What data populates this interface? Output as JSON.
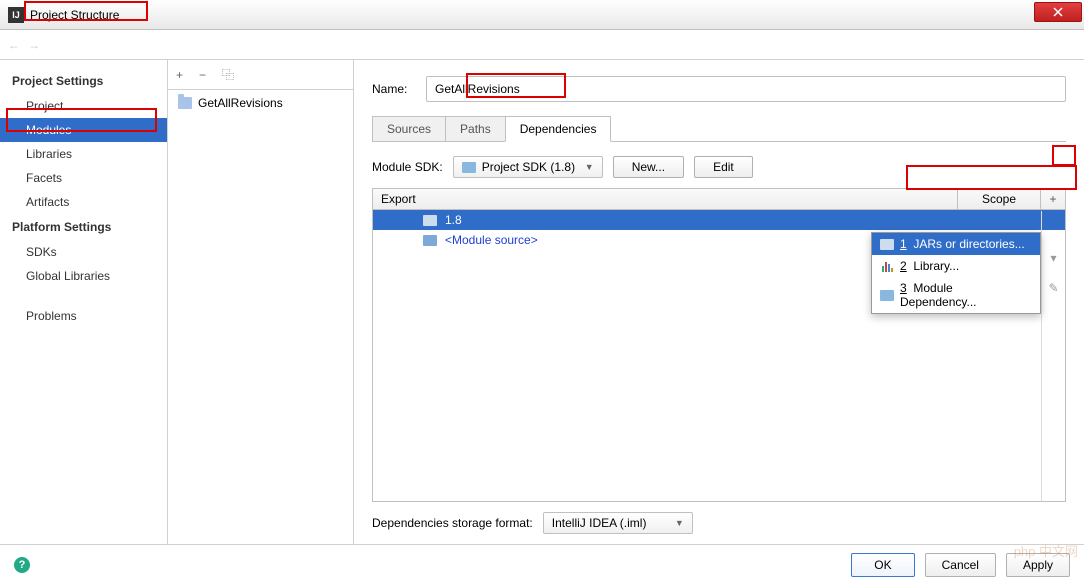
{
  "window": {
    "title": "Project Structure",
    "icon_text": "IJ"
  },
  "sidebar": {
    "sections": [
      {
        "heading": "Project Settings",
        "items": [
          {
            "label": "Project",
            "selected": false
          },
          {
            "label": "Modules",
            "selected": true
          },
          {
            "label": "Libraries",
            "selected": false
          },
          {
            "label": "Facets",
            "selected": false
          },
          {
            "label": "Artifacts",
            "selected": false
          }
        ]
      },
      {
        "heading": "Platform Settings",
        "items": [
          {
            "label": "SDKs",
            "selected": false
          },
          {
            "label": "Global Libraries",
            "selected": false
          }
        ]
      },
      {
        "heading": "",
        "items": [
          {
            "label": "Problems",
            "selected": false
          }
        ]
      }
    ]
  },
  "middle": {
    "toolbar_icons": {
      "add": "+",
      "remove": "−",
      "copy": "⿻"
    },
    "items": [
      {
        "label": "GetAllRevisions"
      }
    ]
  },
  "content": {
    "name_label": "Name:",
    "name_value": "GetAllRevisions",
    "tabs": [
      {
        "label": "Sources",
        "active": false
      },
      {
        "label": "Paths",
        "active": false
      },
      {
        "label": "Dependencies",
        "active": true
      }
    ],
    "sdk_label": "Module SDK:",
    "sdk_value": "Project SDK (1.8)",
    "sdk_new": "New...",
    "sdk_edit": "Edit",
    "table": {
      "header_export": "Export",
      "header_scope": "Scope",
      "rows": [
        {
          "label": "1.8",
          "selected": true,
          "link": false
        },
        {
          "label": "<Module source>",
          "selected": false,
          "link": true
        }
      ]
    },
    "popup": [
      {
        "num": "1",
        "label": "JARs or directories...",
        "selected": true,
        "icon": "folder"
      },
      {
        "num": "2",
        "label": "Library...",
        "selected": false,
        "icon": "bars"
      },
      {
        "num": "3",
        "label": "Module Dependency...",
        "selected": false,
        "icon": "folder"
      }
    ],
    "storage_label": "Dependencies storage format:",
    "storage_value": "IntelliJ IDEA (.iml)"
  },
  "footer": {
    "ok": "OK",
    "cancel": "Cancel",
    "apply": "Apply"
  },
  "watermark": "php 中文网"
}
